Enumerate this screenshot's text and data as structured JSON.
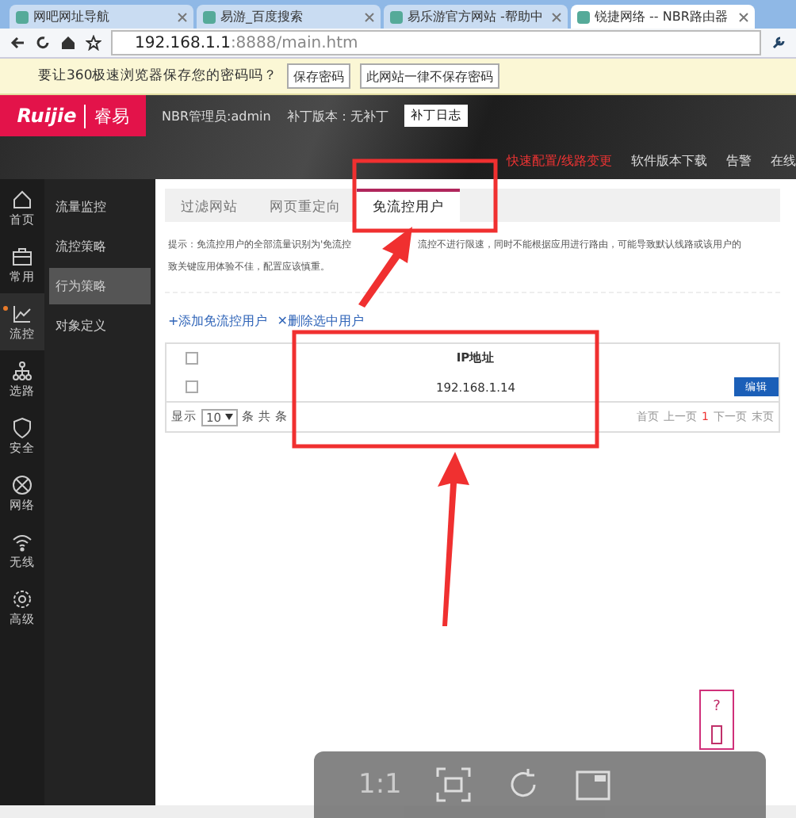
{
  "browser": {
    "tabs": [
      {
        "title": "网吧网址导航",
        "selected": false
      },
      {
        "title": "易游_百度搜索",
        "selected": false
      },
      {
        "title": "易乐游官方网站 -帮助中",
        "selected": false
      },
      {
        "title": "锐捷网络 -- NBR路由器",
        "selected": true
      }
    ],
    "url_host": "192.168.1.1",
    "url_rest": ":8888/main.htm"
  },
  "password_bar": {
    "message": "要让360极速浏览器保存您的密码吗？",
    "buttons": [
      "保存密码",
      "此网站一律不保存密码"
    ]
  },
  "header": {
    "logo": "Ruijie",
    "logo_cn": "睿易",
    "user": "NBR管理员:admin",
    "patch": "补丁版本：无补丁",
    "patch_button": "补丁日志",
    "links": [
      "快速配置/线路变更",
      "软件版本下载",
      "告警",
      "在线"
    ]
  },
  "sidebar": {
    "items": [
      {
        "label": "首页",
        "selected": false
      },
      {
        "label": "常用",
        "selected": false
      },
      {
        "label": "流控",
        "selected": true
      },
      {
        "label": "选路",
        "selected": false
      },
      {
        "label": "安全",
        "selected": false
      },
      {
        "label": "网络",
        "selected": false
      },
      {
        "label": "无线",
        "selected": false
      },
      {
        "label": "高级",
        "selected": false
      }
    ]
  },
  "submenu": [
    {
      "label": "流量监控",
      "selected": false
    },
    {
      "label": "流控策略",
      "selected": false
    },
    {
      "label": "行为策略",
      "selected": true
    },
    {
      "label": "对象定义",
      "selected": false
    }
  ],
  "tabs": [
    {
      "label": "过滤网站",
      "selected": false
    },
    {
      "label": "网页重定向",
      "selected": false
    },
    {
      "label": "免流控用户",
      "selected": true
    }
  ],
  "hint": [
    {
      "parts": [
        "提示：免流控用户的全部流量识别为'免流控",
        "流控不进行限速，同时不能根据应用进行路由，可能导致默认线路或该用户的"
      ]
    },
    {
      "parts": [
        "致关键应用体验不佳，配置应该慎重。"
      ]
    }
  ],
  "actions": [
    "+添加免流控用户",
    "✕删除选中用户"
  ],
  "table": {
    "columns": [
      "IP地址"
    ],
    "rows": [
      {
        "ip": "192.168.1.14",
        "checked": false,
        "action": "编辑"
      }
    ],
    "header_checked": false
  },
  "pager": {
    "show": "显示",
    "size": "10",
    "total": "条 共 条",
    "first": "首页",
    "prev": "上一页",
    "page": "1",
    "next": "下一页",
    "last": "末页"
  },
  "float_help": "?",
  "viewer": {
    "ratio": "1:1"
  }
}
